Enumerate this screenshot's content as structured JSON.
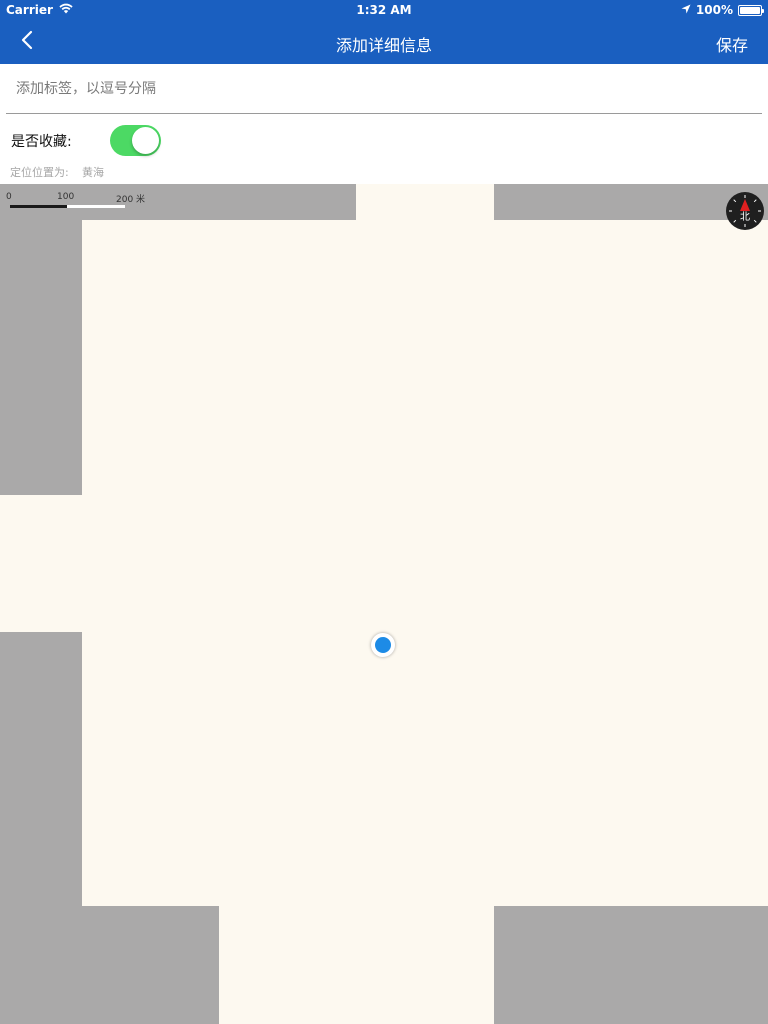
{
  "status_bar": {
    "carrier": "Carrier",
    "time": "1:32 AM",
    "battery": "100%",
    "wifi_icon": "wifi-icon",
    "location_arrow_icon": "location-arrow-icon",
    "battery_icon": "battery-icon"
  },
  "nav": {
    "title": "添加详细信息",
    "save_label": "保存",
    "back_icon": "chevron-left-icon",
    "background_color": "#1a5fc0"
  },
  "tag_input": {
    "placeholder": "添加标签，以逗号分隔",
    "value": ""
  },
  "favorite": {
    "label": "是否收藏:",
    "enabled": true,
    "toggle_color": "#4cd964"
  },
  "location": {
    "prefix": "定位位置为:",
    "value": "黄海"
  },
  "map": {
    "scale": {
      "labels": [
        "0",
        "100",
        "200 米"
      ]
    },
    "compass": {
      "label": "北",
      "icon": "compass-icon"
    },
    "current_location_icon": "location-dot-icon",
    "colors": {
      "land": "#fdf9f0",
      "blocks": "#aaa9a9",
      "location_dot": "#1d8be6"
    }
  }
}
